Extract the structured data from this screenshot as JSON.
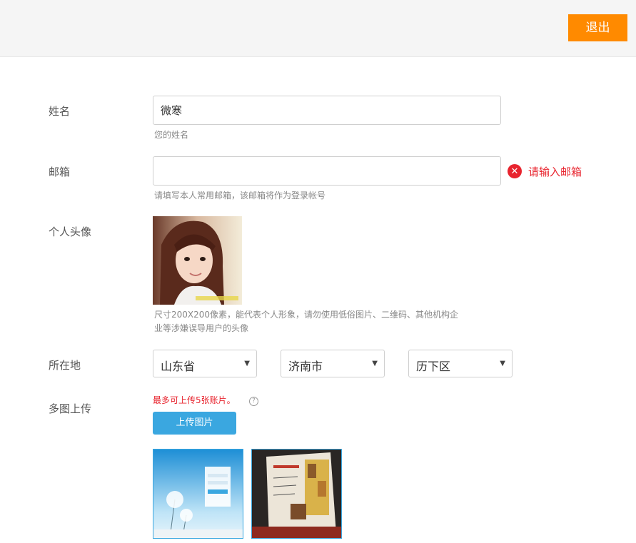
{
  "header": {
    "logout_label": "退出"
  },
  "form": {
    "name": {
      "label": "姓名",
      "value": "微寒",
      "hint": "您的姓名"
    },
    "email": {
      "label": "邮箱",
      "value": "",
      "hint": "请填写本人常用邮箱，该邮箱将作为登录帐号",
      "error": "请输入邮箱"
    },
    "avatar": {
      "label": "个人头像",
      "hint_line1": "尺寸200X200像素，能代表个人形象，请勿使用低俗图片、二维码、其他机构企",
      "hint_line2": "业等涉嫌误导用户的头像"
    },
    "location": {
      "label": "所在地",
      "province": "山东省",
      "city": "济南市",
      "district": "历下区"
    },
    "upload": {
      "label": "多图上传",
      "note": "最多可上传5张账片。",
      "help_symbol": "?",
      "button_label": "上传图片"
    }
  },
  "colors": {
    "accent_orange": "#ff8a00",
    "accent_blue": "#3aa7e0",
    "error_red": "#e8242e"
  },
  "icons": {
    "error": "close-circle-icon",
    "help": "question-circle-icon",
    "caret": "caret-down-icon"
  }
}
